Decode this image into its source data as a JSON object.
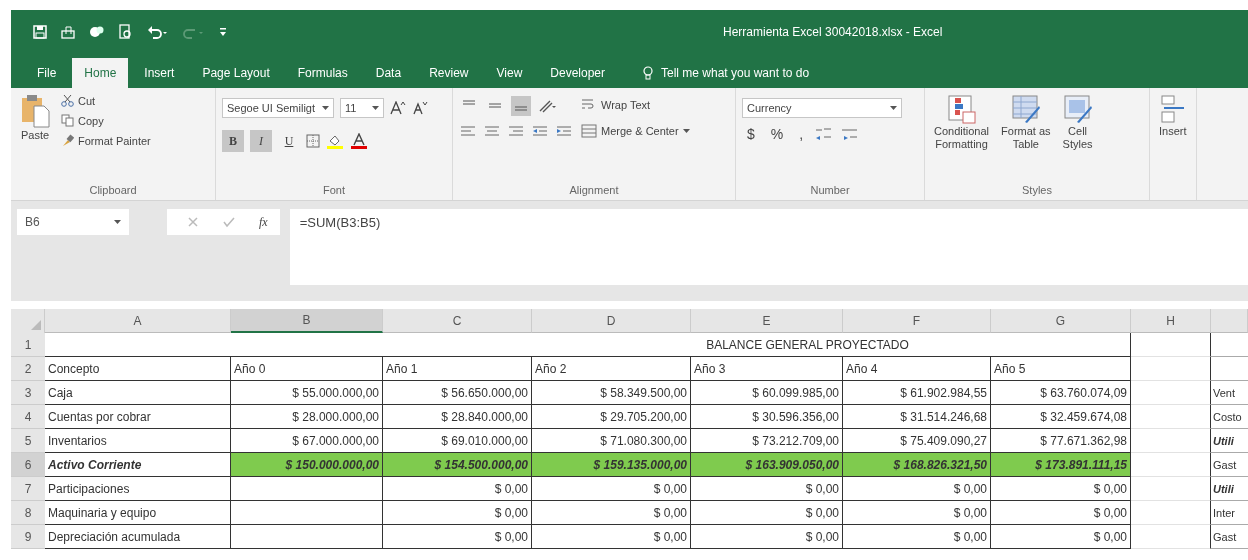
{
  "window": {
    "title": "Herramienta Excel 30042018.xlsx  -  Excel"
  },
  "tabs": [
    {
      "label": "File",
      "selected": false
    },
    {
      "label": "Home",
      "selected": true
    },
    {
      "label": "Insert",
      "selected": false
    },
    {
      "label": "Page Layout",
      "selected": false
    },
    {
      "label": "Formulas",
      "selected": false
    },
    {
      "label": "Data",
      "selected": false
    },
    {
      "label": "Review",
      "selected": false
    },
    {
      "label": "View",
      "selected": false
    },
    {
      "label": "Developer",
      "selected": false
    }
  ],
  "tell_me": {
    "placeholder": "Tell me what you want to do"
  },
  "ribbon": {
    "clipboard": {
      "paste": "Paste",
      "cut": "Cut",
      "copy": "Copy",
      "format_painter": "Format Painter",
      "label": "Clipboard"
    },
    "font": {
      "font_name": "Segoe UI Semiligt",
      "font_size": "11",
      "styles": [
        {
          "label": "B",
          "kind": "bold",
          "selected": true
        },
        {
          "label": "I",
          "kind": "italic",
          "selected": true
        },
        {
          "label": "U",
          "kind": "underline",
          "selected": false
        }
      ],
      "label": "Font"
    },
    "alignment": {
      "vertical": [
        {
          "kind": "top",
          "selected": false
        },
        {
          "kind": "middle",
          "selected": false
        },
        {
          "kind": "bottom",
          "selected": true
        }
      ],
      "wrap_text": "Wrap Text",
      "merge_center": "Merge & Center",
      "label": "Alignment"
    },
    "number": {
      "format": "Currency",
      "currency": "$",
      "percent": "%",
      "comma": ",",
      "label": "Number"
    },
    "styles": {
      "conditional": [
        "Conditional",
        "Formatting"
      ],
      "format_table": [
        "Format as",
        "Table"
      ],
      "cell_styles": [
        "Cell",
        "Styles"
      ],
      "label": "Styles"
    },
    "cells": {
      "insert": "Insert"
    }
  },
  "formula_bar": {
    "name_box": "B6",
    "fx": "fx",
    "formula": "=SUM(B3:B5)"
  },
  "sheet": {
    "columns": [
      {
        "label": "A",
        "selected": false
      },
      {
        "label": "B",
        "selected": true
      },
      {
        "label": "C",
        "selected": false
      },
      {
        "label": "D",
        "selected": false
      },
      {
        "label": "E",
        "selected": false
      },
      {
        "label": "F",
        "selected": false
      },
      {
        "label": "G",
        "selected": false
      },
      {
        "label": "H",
        "selected": false
      }
    ],
    "title_row": {
      "number": "1",
      "selected": false,
      "text": "BALANCE GENERAL PROYECTADO"
    },
    "rows": [
      {
        "number": "2",
        "selected": false,
        "total": false,
        "cells": [
          "Concepto",
          "Año 0",
          "Año 1",
          "Año 2",
          "Año 3",
          "Año 4",
          "Año 5"
        ]
      },
      {
        "number": "3",
        "selected": false,
        "total": false,
        "cells": [
          "Caja",
          "$ 55.000.000,00",
          "$ 56.650.000,00",
          "$ 58.349.500,00",
          "$ 60.099.985,00",
          "$ 61.902.984,55",
          "$ 63.760.074,09"
        ],
        "side": {
          "text": "Vent",
          "bold": false
        }
      },
      {
        "number": "4",
        "selected": false,
        "total": false,
        "cells": [
          "Cuentas por cobrar",
          "$ 28.000.000,00",
          "$ 28.840.000,00",
          "$ 29.705.200,00",
          "$ 30.596.356,00",
          "$ 31.514.246,68",
          "$ 32.459.674,08"
        ],
        "side": {
          "text": "Costo",
          "bold": false
        }
      },
      {
        "number": "5",
        "selected": false,
        "total": false,
        "cells": [
          "Inventarios",
          "$ 67.000.000,00",
          "$ 69.010.000,00",
          "$ 71.080.300,00",
          "$ 73.212.709,00",
          "$ 75.409.090,27",
          "$ 77.671.362,98"
        ],
        "side": {
          "text": "Utili",
          "bold": true
        }
      },
      {
        "number": "6",
        "selected": true,
        "total": true,
        "cells": [
          "Activo  Corriente",
          "$ 150.000.000,00",
          "$ 154.500.000,00",
          "$ 159.135.000,00",
          "$ 163.909.050,00",
          "$ 168.826.321,50",
          "$ 173.891.111,15"
        ],
        "side": {
          "text": "Gast",
          "bold": false
        }
      },
      {
        "number": "7",
        "selected": false,
        "total": false,
        "cells": [
          "Participaciones",
          "",
          "$ 0,00",
          "$ 0,00",
          "$ 0,00",
          "$ 0,00",
          "$ 0,00"
        ],
        "side": {
          "text": "Utili",
          "bold": true
        }
      },
      {
        "number": "8",
        "selected": false,
        "total": false,
        "cells": [
          "Maquinaria y equipo",
          "",
          "$ 0,00",
          "$ 0,00",
          "$ 0,00",
          "$ 0,00",
          "$ 0,00"
        ],
        "side": {
          "text": "Inter",
          "bold": false
        }
      },
      {
        "number": "9",
        "selected": false,
        "total": false,
        "cells": [
          "Depreciación acumulada",
          "",
          "$ 0,00",
          "$ 0,00",
          "$ 0,00",
          "$ 0,00",
          "$ 0,00"
        ],
        "side": {
          "text": "Gast",
          "bold": false
        }
      }
    ]
  }
}
